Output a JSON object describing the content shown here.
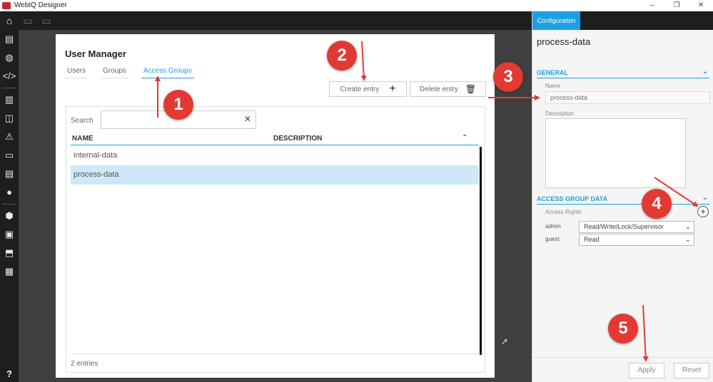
{
  "window": {
    "title": "WebIQ Designer",
    "controls": [
      "–",
      "❐",
      "✕"
    ]
  },
  "toolbar": {
    "home_icon": "⌂",
    "copy_icon": "▭",
    "paste_icon": "▭"
  },
  "sidebar": {
    "items": [
      "▤",
      "◍",
      "</>",
      "▥",
      "◫",
      "⚠",
      "▭",
      "▤",
      "●",
      "⬢",
      "▣",
      "⬒",
      "▦"
    ],
    "help": "?"
  },
  "user_manager": {
    "title": "User Manager",
    "tabs": [
      {
        "label": "Users",
        "active": false
      },
      {
        "label": "Groups",
        "active": false
      },
      {
        "label": "Access Groups",
        "active": true
      }
    ],
    "create_label": "Create entry",
    "create_icon": "+",
    "delete_label": "Delete entry",
    "delete_icon": "🗑",
    "search_label": "Search",
    "search_value": "",
    "search_clear": "✕",
    "columns": [
      "NAME",
      "DESCRIPTION"
    ],
    "sort_icon": "⌃",
    "rows": [
      {
        "name": "internal-data",
        "description": "",
        "selected": false
      },
      {
        "name": "process-data",
        "description": "",
        "selected": true
      }
    ],
    "count": "2 entries"
  },
  "config": {
    "tab": "Configuration",
    "title": "process-data",
    "general": {
      "heading": "GENERAL",
      "name_label": "Name",
      "name_placeholder": "process-data",
      "description_label": "Description"
    },
    "access": {
      "heading": "ACCESS GROUP DATA",
      "rights_label": "Access Rights",
      "add_icon": "+",
      "rights": [
        {
          "user": "admin",
          "value": "Read/Write/Lock/Supervisor"
        },
        {
          "user": "guest",
          "value": "Read"
        }
      ]
    },
    "apply_label": "Apply",
    "reset_label": "Reset",
    "chevron": "⌄"
  },
  "annotations": [
    "1",
    "2",
    "3",
    "4",
    "5"
  ],
  "colors": {
    "accent": "#1ba1e2",
    "callout": "#e23a33",
    "dark": "#1e1e1e",
    "selected_row": "#cde8f7"
  }
}
